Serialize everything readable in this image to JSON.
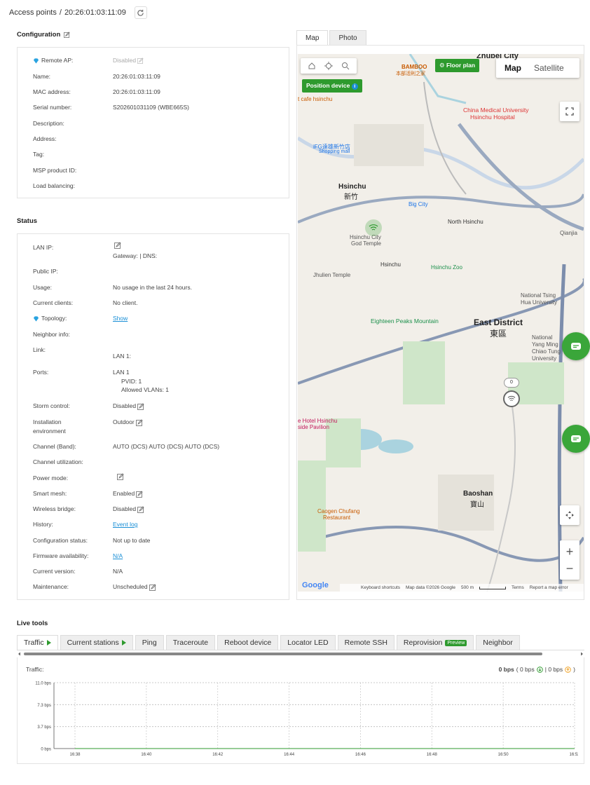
{
  "header": {
    "breadcrumb_root": "Access points",
    "separator": "/",
    "device_name": "20:26:01:03:11:09"
  },
  "configuration": {
    "title": "Configuration",
    "rows": [
      {
        "label": "Remote AP:",
        "value": "Disabled"
      },
      {
        "label": "Name:",
        "value": "20:26:01:03:11:09"
      },
      {
        "label": "MAC address:",
        "value": "20:26:01:03:11:09"
      },
      {
        "label": "Serial number:",
        "value": "S202601031109 (WBE665S)"
      },
      {
        "label": "Description:",
        "value": ""
      },
      {
        "label": "Address:",
        "value": ""
      },
      {
        "label": "Tag:",
        "value": ""
      },
      {
        "label": "MSP product ID:",
        "value": ""
      },
      {
        "label": "Load balancing:",
        "value": ""
      }
    ]
  },
  "status": {
    "title": "Status",
    "lan_ip_label": "LAN IP:",
    "lan_ip_gateway": "Gateway:  |  DNS:",
    "public_ip_label": "Public IP:",
    "usage_label": "Usage:",
    "usage_value": "No usage in the last 24 hours.",
    "clients_label": "Current clients:",
    "clients_value": "No client.",
    "topology_label": "Topology:",
    "topology_value": "Show",
    "neighbor_label": "Neighbor info:",
    "link_label": "Link:",
    "link_value": "LAN 1:",
    "ports_label": "Ports:",
    "ports_lan": "LAN 1",
    "ports_pvid": "PVID: 1",
    "ports_vlans": "Allowed VLANs:  1",
    "storm_label": "Storm control:",
    "storm_value": "Disabled",
    "install_label_1": "Installation",
    "install_label_2": "environment",
    "install_value": "Outdoor",
    "channel_label": "Channel (Band):",
    "channel_value": "AUTO (DCS) AUTO (DCS) AUTO (DCS)",
    "chutil_label": "Channel utilization:",
    "power_label": "Power mode:",
    "mesh_label": "Smart mesh:",
    "mesh_value": "Enabled",
    "bridge_label": "Wireless bridge:",
    "bridge_value": "Disabled",
    "history_label": "History:",
    "history_value": "Event log",
    "cfgstatus_label": "Configuration status:",
    "cfgstatus_value": "Not up to date",
    "fw_label": "Firmware availability:",
    "fw_value": "N/A",
    "version_label": "Current version:",
    "version_value": "N/A",
    "maint_label": "Maintenance:",
    "maint_value": "Unscheduled"
  },
  "map": {
    "tabs": [
      "Map",
      "Photo"
    ],
    "floor_plan": "Floor plan",
    "position_device": "Position device",
    "map_type": [
      "Map",
      "Satellite"
    ],
    "labels": {
      "zhubei": "Zhubei City",
      "bamboo": "BAMBOO",
      "bamboo_cn": "本部活則之家",
      "hsinchu": "Hsinchu",
      "hsinchu_cn": "新竹",
      "east_district": "East District",
      "east_cn": "東區",
      "big_city": "Big City",
      "north_hsinchu": "North Hsinchu",
      "zoo": "Hsinchu Zoo",
      "jhulien": "Jhulien Temple",
      "eighteen": "Eighteen Peaks Mountain",
      "china_med": "China Medical University",
      "china_med2": "Hsinchu Hospital",
      "tsing_hua": "National Tsing",
      "tsing_hua2": "Hua University",
      "yang_ming": "National",
      "yang_ming2": "Yang Ming",
      "yang_ming3": "Chiao Tung",
      "yang_ming4": "University",
      "baoshan": "Baoshan",
      "baoshan_cn": "寶山",
      "caogen": "Caogen Chufang",
      "caogen2": "Restaurant",
      "qianjia": "Qianjia",
      "hotel": "e Hotel Hsinchu",
      "pavilion": "side Pavilion",
      "city_god": "Hsinchu City",
      "city_god2": "God Temple",
      "cafe": "t cafe hsinchu",
      "ifg": "iFG遠雄新竹店",
      "shopping": "Shopping mall",
      "hsinchu_temple": "Hsinchu"
    },
    "footer": {
      "google": "Google",
      "shortcuts": "Keyboard shortcuts",
      "mapdata": "Map data ©2026 Google",
      "scale": "500 m",
      "terms": "Terms",
      "report": "Report a map error"
    },
    "cluster_count": "0"
  },
  "live_tools": {
    "title": "Live tools",
    "tabs": [
      "Traffic",
      "Current stations",
      "Ping",
      "Traceroute",
      "Reboot device",
      "Locator LED",
      "Remote SSH",
      "Reprovision",
      "Neighbor"
    ],
    "preview_badge": "Preview",
    "traffic_label": "Traffic:",
    "traffic_total": "0 bps",
    "traffic_down": "( 0 bps",
    "traffic_up": "| 0 bps",
    "traffic_close": ")"
  },
  "chart_data": {
    "type": "line",
    "title": "",
    "xlabel": "",
    "ylabel": "",
    "x": [
      "16:38",
      "16:40",
      "16:42",
      "16:44",
      "16:46",
      "16:48",
      "16:50",
      "16:52"
    ],
    "yticks": [
      "11.0 bps",
      "7.3 bps",
      "3.7 bps",
      "0 bps"
    ],
    "ylim": [
      0,
      11.0
    ],
    "series": [
      {
        "values": [
          0,
          0,
          0,
          0,
          0,
          0,
          0,
          0
        ]
      }
    ]
  }
}
